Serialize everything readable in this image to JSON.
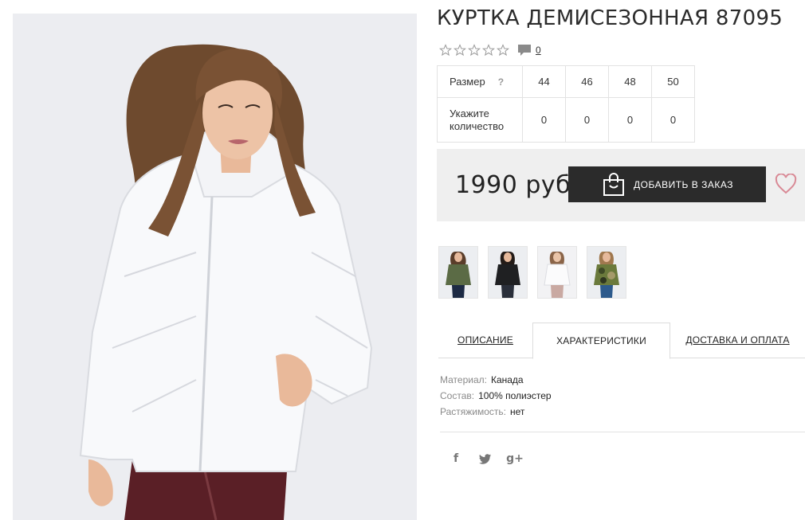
{
  "product": {
    "title": "КУРТКА ДЕМИСЕЗОННАЯ 87095",
    "rating_stars": 0,
    "rating_max": 5,
    "comments_count": "0"
  },
  "size_table": {
    "size_label": "Размер",
    "help_mark": "?",
    "quantity_label": "Укажите количество",
    "sizes": [
      "44",
      "46",
      "48",
      "50"
    ],
    "quantities": [
      "0",
      "0",
      "0",
      "0"
    ]
  },
  "price": "1990 руб",
  "add_to_order_label": "ДОБАВИТЬ В ЗАКАЗ",
  "thumbnails": [
    {
      "name": "thumb-olive-jacket",
      "jacket_color": "#5b6b45"
    },
    {
      "name": "thumb-black-jacket",
      "jacket_color": "#1f2022"
    },
    {
      "name": "thumb-white-jacket",
      "jacket_color": "#f4f4f6"
    },
    {
      "name": "thumb-camo-jacket",
      "jacket_color": "#6b7a3c"
    }
  ],
  "tabs": [
    {
      "label": "ОПИСАНИЕ",
      "active": false
    },
    {
      "label": "ХАРАКТЕРИСТИКИ",
      "active": true
    },
    {
      "label": "ДОСТАВКА И ОПЛАТА",
      "active": false
    }
  ],
  "specs": [
    {
      "key": "Материал:",
      "value": "Канада"
    },
    {
      "key": "Состав:",
      "value": "100% полиэстер"
    },
    {
      "key": "Растяжимость:",
      "value": "нет"
    }
  ],
  "social": {
    "facebook": "f",
    "twitter": "twitter-icon",
    "googleplus": "g+"
  },
  "colors": {
    "button_bg": "#2b2b2b",
    "price_box_bg": "#efefef",
    "heart": "#d98a96",
    "photo_bg": "#ecedf1"
  }
}
